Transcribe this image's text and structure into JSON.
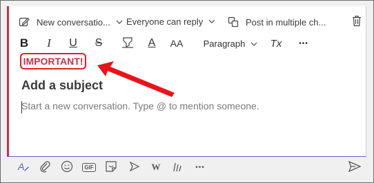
{
  "toolbar_top": {
    "format_label": "New conversatio...",
    "reply_label": "Everyone can reply",
    "multi_label": "Post in multiple ch..."
  },
  "format_bar": {
    "bold": "B",
    "italic": "I",
    "underline": "U",
    "strike": "S",
    "fontcolor": "A",
    "fontsize": "AA",
    "paragraph": "Paragraph",
    "clear": "Tx",
    "more": "•••"
  },
  "compose": {
    "important_label": "IMPORTANT!",
    "subject_placeholder": "Add a subject",
    "body_placeholder": "Start a new conversation. Type @ to mention someone."
  },
  "bottom_bar": {
    "gif": "GIF",
    "w": "W",
    "more": "•••"
  },
  "colors": {
    "important": "#c4314b",
    "annotation": "#e02020",
    "accent": "#6a5fb3"
  },
  "icons": [
    "edit-icon",
    "chevron-down-icon",
    "copy-icon",
    "trash-icon",
    "highlight-icon",
    "paper-clip-icon",
    "emoji-icon",
    "sticker-icon",
    "meet-icon",
    "stream-icon",
    "praise-icon",
    "send-icon",
    "format-icon",
    "arrow-annotation-icon"
  ]
}
